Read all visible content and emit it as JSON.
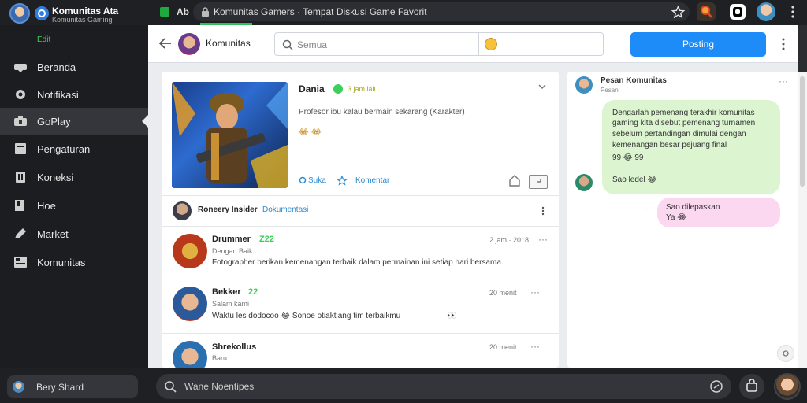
{
  "app": {
    "name": "Komunitas Ata",
    "subtitle": "Komunitas Gaming"
  },
  "browser": {
    "tab_letters": "Ab",
    "url": "Komunitas Gamers · Tempat Diskusi Game Favorit"
  },
  "sidebar": {
    "status_tag": "Edit",
    "items": [
      {
        "label": "Beranda",
        "icon": "game-icon"
      },
      {
        "label": "Notifikasi",
        "icon": "bell-icon"
      },
      {
        "label": "GoPlay",
        "icon": "controller-icon"
      },
      {
        "label": "Pengaturan",
        "icon": "page-icon"
      },
      {
        "label": "Koneksi",
        "icon": "connection-icon"
      },
      {
        "label": "Hoe",
        "icon": "bookmark-icon"
      },
      {
        "label": "Market",
        "icon": "pencil-icon"
      },
      {
        "label": "Komunitas",
        "icon": "community-icon"
      }
    ],
    "active_index": 2,
    "bottom_button": "Bery Shard"
  },
  "header": {
    "page_title": "Komunitas",
    "search_placeholder": "Semua",
    "action_button": "Posting"
  },
  "post": {
    "author": "Dania",
    "author_meta": "3 jam lalu",
    "body": "Profesor ibu kalau bermain sekarang (Karakter)",
    "emojis": "😂 😂",
    "like_label": "Suka",
    "comment_label": "Komentar"
  },
  "composer": {
    "name": "Roneery Insider",
    "link": "Dokumentasi"
  },
  "comments": [
    {
      "name": "Drummer",
      "badge": "Z22",
      "time": "2 jam · 2018",
      "text": "Fotographer berikan kemenangan terbaik dalam permainan ini setiap hari bersama.",
      "sub": "Dengan Baik"
    },
    {
      "name": "Bekker",
      "badge": "22",
      "time": "20 menit",
      "text": "Waktu les dodocoo 😂 Sonoe otiaktiang tim terbaikmu",
      "sub": "Salam kami",
      "tail": "👀"
    },
    {
      "name": "Shrekollus",
      "badge": "",
      "time": "20 menit",
      "text": "",
      "sub": "Baru"
    }
  ],
  "chat": {
    "title": "Pesan Komunitas",
    "subtitle": "Pesan",
    "bubble1": [
      "Dengarlah pemenang terakhir komunitas",
      "gaming kita disebut pemenang turnamen",
      "sebelum pertandingan dimulai dengan",
      "kemenangan besar pejuang final",
      "99 😂 99"
    ],
    "reply_text": "Sao ledel 😂",
    "bubble2": [
      "Sao dilepaskan",
      "Ya 😂"
    ]
  },
  "bottombar": {
    "search_placeholder": "Wane Noentipes"
  },
  "colors": {
    "accent": "#1d8cf8",
    "green_bubble": "#dcf5d0",
    "pink_bubble": "#fbd7f0",
    "sidebar_bg": "#1c1d20",
    "active_nav": "#34363b"
  }
}
